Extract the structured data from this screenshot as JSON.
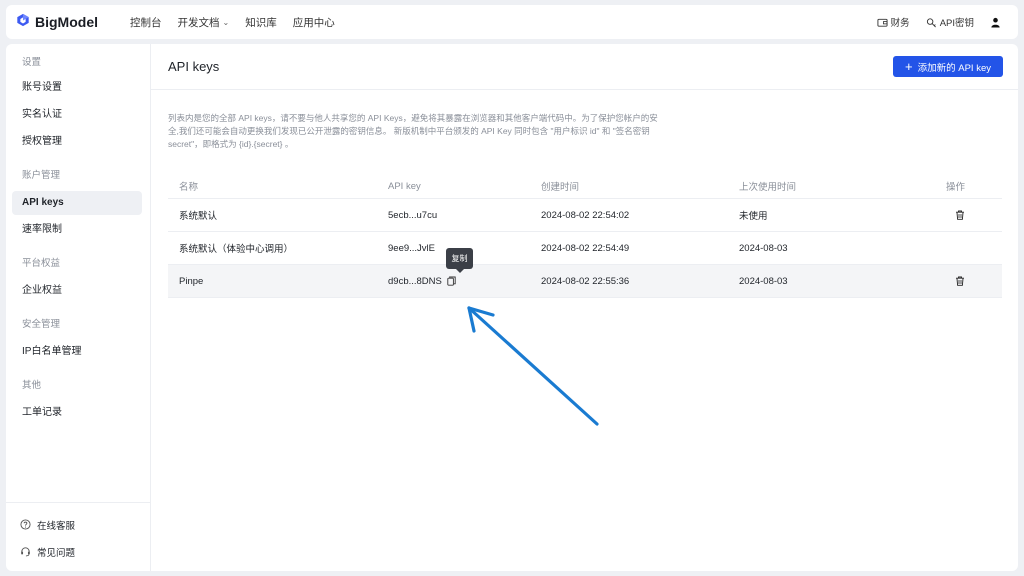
{
  "brand": {
    "name": "BigModel"
  },
  "nav": {
    "items": [
      {
        "label": "控制台"
      },
      {
        "label": "开发文档",
        "dropdown": true
      },
      {
        "label": "知识库"
      },
      {
        "label": "应用中心"
      }
    ],
    "right": {
      "finance": "财务",
      "api_key": "API密钥"
    }
  },
  "sidebar": {
    "groups": [
      {
        "title": "设置",
        "items": [
          "账号设置",
          "实名认证",
          "授权管理"
        ]
      },
      {
        "title": "账户管理",
        "items": [
          "API keys",
          "速率限制"
        ]
      },
      {
        "title": "平台权益",
        "items": [
          "企业权益"
        ]
      },
      {
        "title": "安全管理",
        "items": [
          "IP白名单管理"
        ]
      },
      {
        "title": "其他",
        "items": [
          "工单记录"
        ]
      }
    ],
    "active": "API keys",
    "footer": {
      "support": "在线客服",
      "faq": "常见问题"
    }
  },
  "main": {
    "title": "API keys",
    "add_button": "添加新的 API key",
    "description": "列表内是您的全部 API keys，请不要与他人共享您的 API Keys，避免将其暴露在浏览器和其他客户端代码中。为了保护您帐户的安全,我们还可能会自动更换我们发现已公开泄露的密钥信息。 新版机制中平台颁发的 API Key 同时包含 \"用户标识 id\" 和 \"签名密钥 secret\"，即格式为 {id}.{secret} 。",
    "table": {
      "columns": [
        "名称",
        "API key",
        "创建时间",
        "上次使用时间",
        "操作"
      ],
      "rows": [
        {
          "name": "系统默认",
          "key": "5ecb...u7cu",
          "created": "2024-08-02 22:54:02",
          "last_used": "未使用"
        },
        {
          "name": "系统默认（体验中心调用）",
          "key": "9ee9...JvlE",
          "created": "2024-08-02 22:54:49",
          "last_used": "2024-08-03"
        },
        {
          "name": "Pinpe",
          "key": "d9cb...8DNS",
          "created": "2024-08-02 22:55:36",
          "last_used": "2024-08-03"
        }
      ]
    },
    "tooltip": "复制"
  },
  "colors": {
    "accent": "#2354e8",
    "arrow": "#1a7bd1",
    "brand_icon": "#3d5af1"
  }
}
